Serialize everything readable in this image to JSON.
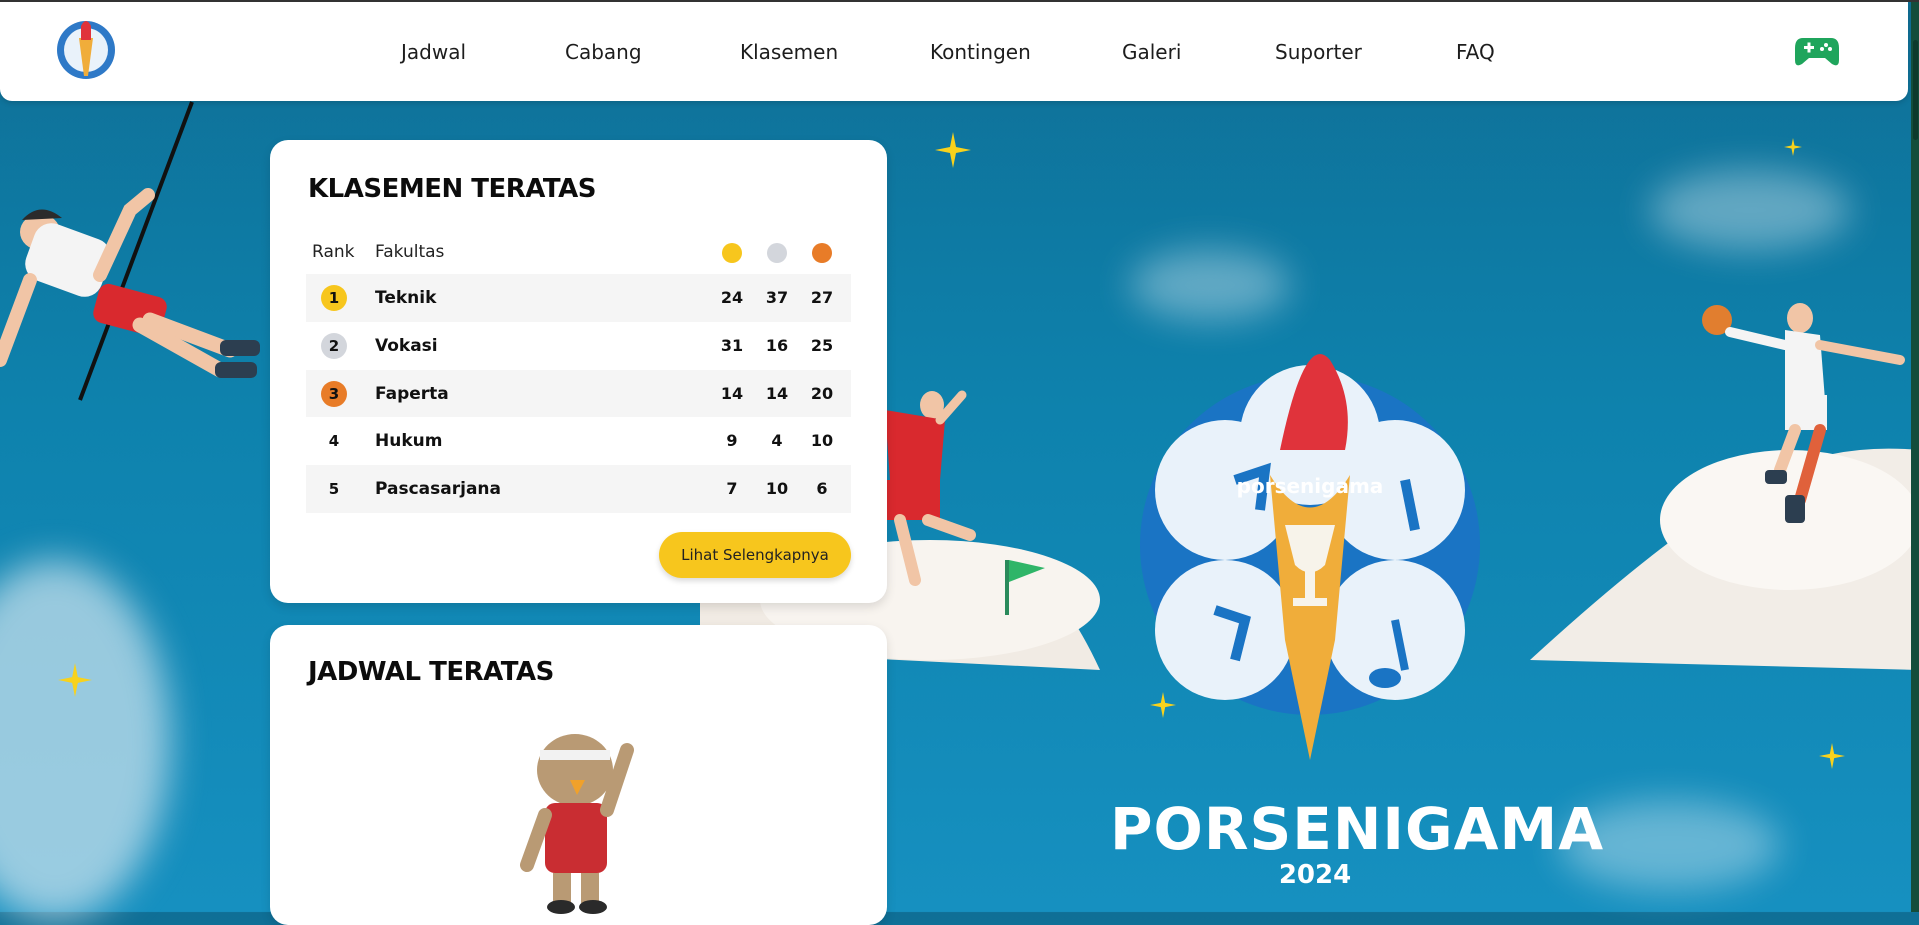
{
  "nav": {
    "items": [
      "Jadwal",
      "Cabang",
      "Klasemen",
      "Kontingen",
      "Galeri",
      "Suporter",
      "FAQ"
    ]
  },
  "icons": {
    "logo": "porsenigama-logo",
    "game": "gamepad-icon"
  },
  "colors": {
    "gold": "#f7c61d",
    "silver": "#d3d6dc",
    "bronze": "#e87c28",
    "game_icon": "#1fa55c",
    "button": "#f7c61d"
  },
  "standings": {
    "title": "KLASEMEN TERATAS",
    "headers": {
      "rank": "Rank",
      "faculty": "Fakultas"
    },
    "rows": [
      {
        "rank": "1",
        "faculty": "Teknik",
        "gold": "24",
        "silver": "37",
        "bronze": "27"
      },
      {
        "rank": "2",
        "faculty": "Vokasi",
        "gold": "31",
        "silver": "16",
        "bronze": "25"
      },
      {
        "rank": "3",
        "faculty": "Faperta",
        "gold": "14",
        "silver": "14",
        "bronze": "20"
      },
      {
        "rank": "4",
        "faculty": "Hukum",
        "gold": "9",
        "silver": "4",
        "bronze": "10"
      },
      {
        "rank": "5",
        "faculty": "Pascasarjana",
        "gold": "7",
        "silver": "10",
        "bronze": "6"
      }
    ],
    "more_button": "Lihat Selengkapnya"
  },
  "schedule": {
    "title": "JADWAL TERATAS"
  },
  "hero": {
    "logo_text": "porsenigama",
    "title": "PORSENIGAMA",
    "year": "2024"
  }
}
